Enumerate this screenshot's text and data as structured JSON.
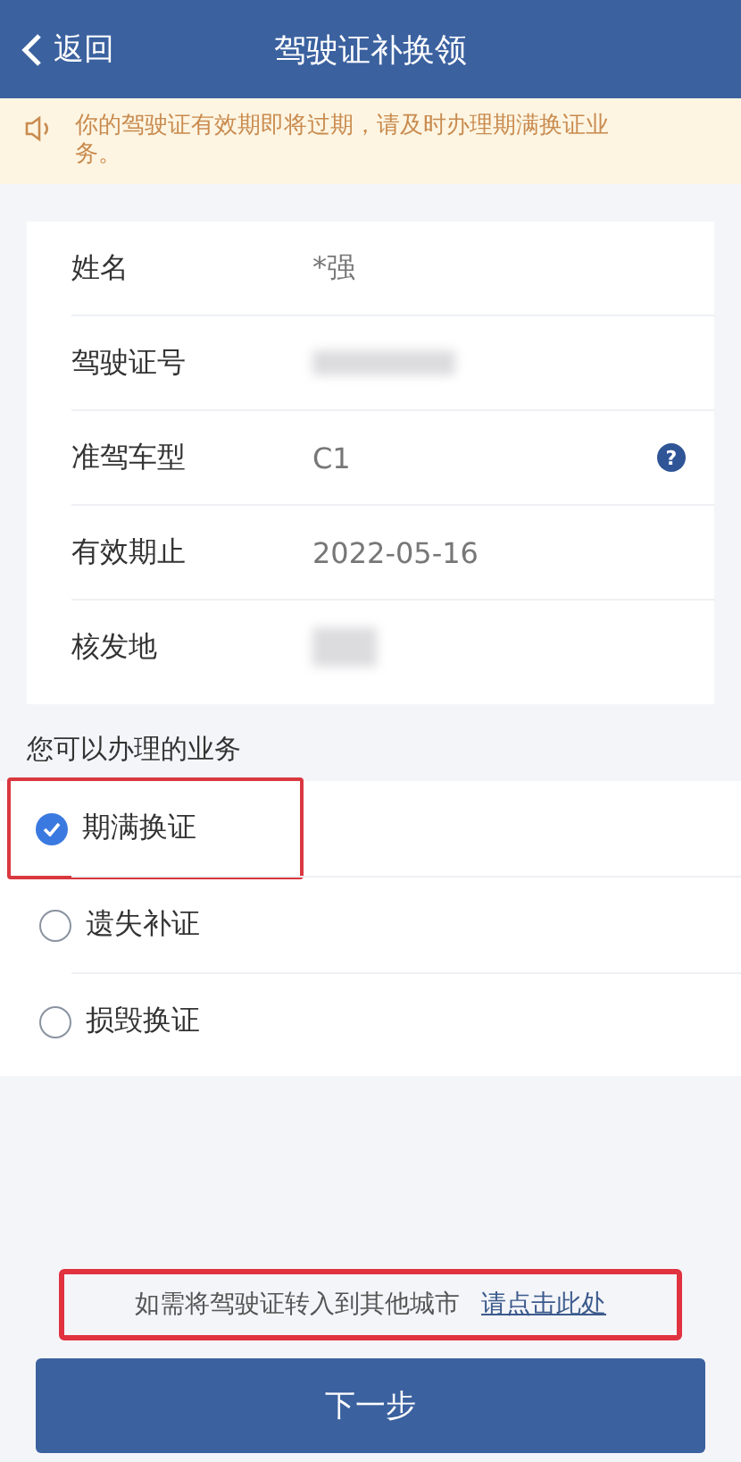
{
  "header": {
    "back": "返回",
    "title": "驾驶证补换领"
  },
  "notice": "你的驾驶证有效期即将过期，请及时办理期满换证业务。",
  "info_rows": [
    {
      "label": "姓名",
      "value": "*强",
      "blurred": false,
      "help": false
    },
    {
      "label": "驾驶证号",
      "blurred": true,
      "help": false
    },
    {
      "label": "准驾车型",
      "value": "C1",
      "blurred": false,
      "help": true,
      "help_icon": "?"
    },
    {
      "label": "有效期止",
      "value": "2022-05-16",
      "blurred": false,
      "help": false
    },
    {
      "label": "核发地",
      "blurred": true,
      "help": false
    }
  ],
  "services_title": "您可以办理的业务",
  "services": [
    {
      "label": "期满换证",
      "selected": true,
      "highlighted": true
    },
    {
      "label": "遗失补证",
      "selected": false,
      "highlighted": false
    },
    {
      "label": "损毁换证",
      "selected": false,
      "highlighted": false
    }
  ],
  "transfer": {
    "text": "如需将驾驶证转入到其他城市",
    "link": "请点击此处",
    "highlighted": true
  },
  "next_button": "下一步"
}
